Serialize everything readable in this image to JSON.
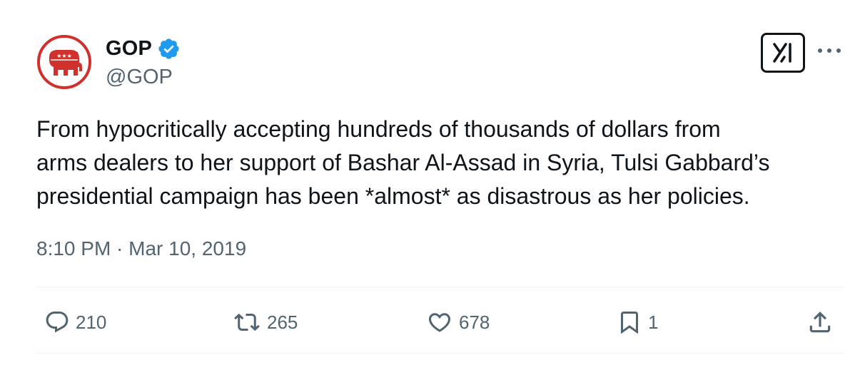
{
  "tweet": {
    "author": {
      "display_name": "GOP",
      "handle": "@GOP",
      "verified": true,
      "avatar": "gop-elephant-logo"
    },
    "text_lines": [
      "From hypocritically accepting hundreds of thousands of dollars from",
      "arms dealers to her support of Bashar Al-Assad in Syria, Tulsi Gabbard’s",
      "presidential campaign has been *almost* as disastrous as her policies."
    ],
    "timestamp": "8:10 PM · Mar 10, 2019",
    "stats": {
      "replies": "210",
      "reposts": "265",
      "likes": "678",
      "bookmarks": "1"
    }
  },
  "icons": {
    "verified": "verified-badge-icon",
    "grok": "grok-icon",
    "more": "more-options-icon",
    "reply": "reply-icon",
    "repost": "repost-icon",
    "like": "heart-icon",
    "bookmark": "bookmark-icon",
    "share": "share-icon"
  },
  "colors": {
    "text": "#0f1419",
    "secondary": "#536471",
    "verified_blue": "#1d9bf0",
    "gop_red": "#d0312d"
  }
}
